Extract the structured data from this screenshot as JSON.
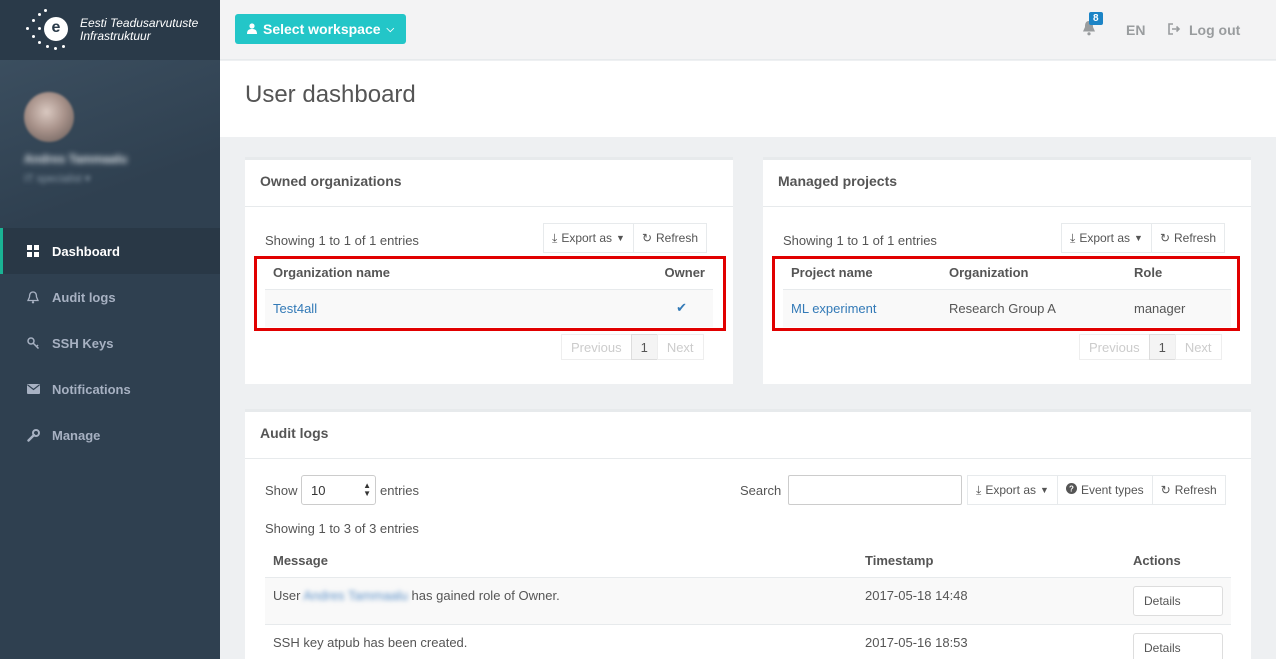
{
  "brand": {
    "line1": "Eesti Teadusarvutuste",
    "line2": "Infrastruktuur",
    "logo_letter": "e"
  },
  "profile": {
    "name": "Andres Tammaalu",
    "role": "IT specialist ▾"
  },
  "nav": [
    {
      "label": "Dashboard",
      "icon": "grid-icon"
    },
    {
      "label": "Audit logs",
      "icon": "bell-icon"
    },
    {
      "label": "SSH Keys",
      "icon": "key-icon"
    },
    {
      "label": "Notifications",
      "icon": "envelope-icon"
    },
    {
      "label": "Manage",
      "icon": "wrench-icon"
    }
  ],
  "topbar": {
    "workspace_label": "Select workspace",
    "notification_count": "8",
    "language": "EN",
    "logout_label": "Log out"
  },
  "page_title": "User dashboard",
  "owned_orgs": {
    "title": "Owned organizations",
    "info": "Showing 1 to 1 of 1 entries",
    "export_label": "Export as",
    "refresh_label": "Refresh",
    "columns": [
      "Organization name",
      "Owner"
    ],
    "rows": [
      {
        "name": "Test4all",
        "owner_mark": "✔"
      }
    ],
    "pager": {
      "prev": "Previous",
      "page": "1",
      "next": "Next"
    }
  },
  "managed_projects": {
    "title": "Managed projects",
    "info": "Showing 1 to 1 of 1 entries",
    "export_label": "Export as",
    "refresh_label": "Refresh",
    "columns": [
      "Project name",
      "Organization",
      "Role"
    ],
    "rows": [
      {
        "project": "ML experiment",
        "organization": "Research Group A",
        "role": "manager"
      }
    ],
    "pager": {
      "prev": "Previous",
      "page": "1",
      "next": "Next"
    }
  },
  "audit_logs": {
    "title": "Audit logs",
    "show_label": "Show",
    "page_size": "10",
    "entries_label": "entries",
    "search_label": "Search",
    "export_label": "Export as",
    "event_types_label": "Event types",
    "refresh_label": "Refresh",
    "info": "Showing 1 to 3 of 3 entries",
    "columns": [
      "Message",
      "Timestamp",
      "Actions"
    ],
    "rows": [
      {
        "msg_prefix": "User",
        "msg_user": "Andres Tammaalu",
        "msg_suffix": "has gained role of Owner.",
        "timestamp": "2017-05-18 14:48",
        "action": "Details"
      },
      {
        "message": "SSH key atpub has been created.",
        "timestamp": "2017-05-16 18:53",
        "action": "Details"
      }
    ]
  },
  "colors": {
    "sidebar": "#2f4050",
    "accent": "#1ab394",
    "workspace_button": "#23c6c8",
    "highlight_box": "#e10000",
    "link": "#337ab7"
  }
}
